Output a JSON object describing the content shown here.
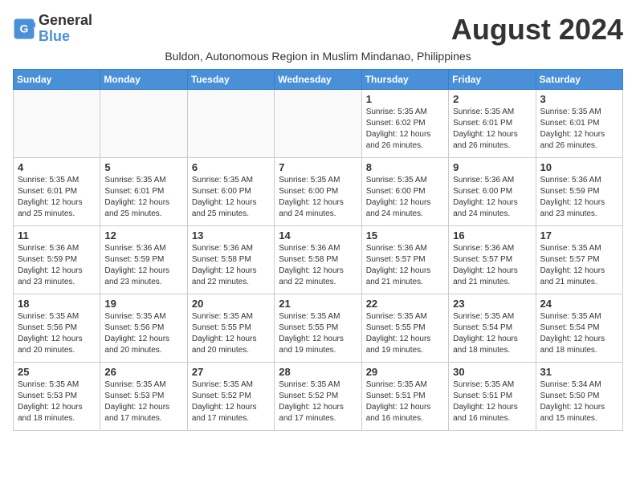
{
  "logo": {
    "line1": "General",
    "line2": "Blue"
  },
  "title": "August 2024",
  "subtitle": "Buldon, Autonomous Region in Muslim Mindanao, Philippines",
  "days_header": [
    "Sunday",
    "Monday",
    "Tuesday",
    "Wednesday",
    "Thursday",
    "Friday",
    "Saturday"
  ],
  "weeks": [
    [
      {
        "day": "",
        "info": ""
      },
      {
        "day": "",
        "info": ""
      },
      {
        "day": "",
        "info": ""
      },
      {
        "day": "",
        "info": ""
      },
      {
        "day": "1",
        "info": "Sunrise: 5:35 AM\nSunset: 6:02 PM\nDaylight: 12 hours\nand 26 minutes."
      },
      {
        "day": "2",
        "info": "Sunrise: 5:35 AM\nSunset: 6:01 PM\nDaylight: 12 hours\nand 26 minutes."
      },
      {
        "day": "3",
        "info": "Sunrise: 5:35 AM\nSunset: 6:01 PM\nDaylight: 12 hours\nand 26 minutes."
      }
    ],
    [
      {
        "day": "4",
        "info": "Sunrise: 5:35 AM\nSunset: 6:01 PM\nDaylight: 12 hours\nand 25 minutes."
      },
      {
        "day": "5",
        "info": "Sunrise: 5:35 AM\nSunset: 6:01 PM\nDaylight: 12 hours\nand 25 minutes."
      },
      {
        "day": "6",
        "info": "Sunrise: 5:35 AM\nSunset: 6:00 PM\nDaylight: 12 hours\nand 25 minutes."
      },
      {
        "day": "7",
        "info": "Sunrise: 5:35 AM\nSunset: 6:00 PM\nDaylight: 12 hours\nand 24 minutes."
      },
      {
        "day": "8",
        "info": "Sunrise: 5:35 AM\nSunset: 6:00 PM\nDaylight: 12 hours\nand 24 minutes."
      },
      {
        "day": "9",
        "info": "Sunrise: 5:36 AM\nSunset: 6:00 PM\nDaylight: 12 hours\nand 24 minutes."
      },
      {
        "day": "10",
        "info": "Sunrise: 5:36 AM\nSunset: 5:59 PM\nDaylight: 12 hours\nand 23 minutes."
      }
    ],
    [
      {
        "day": "11",
        "info": "Sunrise: 5:36 AM\nSunset: 5:59 PM\nDaylight: 12 hours\nand 23 minutes."
      },
      {
        "day": "12",
        "info": "Sunrise: 5:36 AM\nSunset: 5:59 PM\nDaylight: 12 hours\nand 23 minutes."
      },
      {
        "day": "13",
        "info": "Sunrise: 5:36 AM\nSunset: 5:58 PM\nDaylight: 12 hours\nand 22 minutes."
      },
      {
        "day": "14",
        "info": "Sunrise: 5:36 AM\nSunset: 5:58 PM\nDaylight: 12 hours\nand 22 minutes."
      },
      {
        "day": "15",
        "info": "Sunrise: 5:36 AM\nSunset: 5:57 PM\nDaylight: 12 hours\nand 21 minutes."
      },
      {
        "day": "16",
        "info": "Sunrise: 5:36 AM\nSunset: 5:57 PM\nDaylight: 12 hours\nand 21 minutes."
      },
      {
        "day": "17",
        "info": "Sunrise: 5:35 AM\nSunset: 5:57 PM\nDaylight: 12 hours\nand 21 minutes."
      }
    ],
    [
      {
        "day": "18",
        "info": "Sunrise: 5:35 AM\nSunset: 5:56 PM\nDaylight: 12 hours\nand 20 minutes."
      },
      {
        "day": "19",
        "info": "Sunrise: 5:35 AM\nSunset: 5:56 PM\nDaylight: 12 hours\nand 20 minutes."
      },
      {
        "day": "20",
        "info": "Sunrise: 5:35 AM\nSunset: 5:55 PM\nDaylight: 12 hours\nand 20 minutes."
      },
      {
        "day": "21",
        "info": "Sunrise: 5:35 AM\nSunset: 5:55 PM\nDaylight: 12 hours\nand 19 minutes."
      },
      {
        "day": "22",
        "info": "Sunrise: 5:35 AM\nSunset: 5:55 PM\nDaylight: 12 hours\nand 19 minutes."
      },
      {
        "day": "23",
        "info": "Sunrise: 5:35 AM\nSunset: 5:54 PM\nDaylight: 12 hours\nand 18 minutes."
      },
      {
        "day": "24",
        "info": "Sunrise: 5:35 AM\nSunset: 5:54 PM\nDaylight: 12 hours\nand 18 minutes."
      }
    ],
    [
      {
        "day": "25",
        "info": "Sunrise: 5:35 AM\nSunset: 5:53 PM\nDaylight: 12 hours\nand 18 minutes."
      },
      {
        "day": "26",
        "info": "Sunrise: 5:35 AM\nSunset: 5:53 PM\nDaylight: 12 hours\nand 17 minutes."
      },
      {
        "day": "27",
        "info": "Sunrise: 5:35 AM\nSunset: 5:52 PM\nDaylight: 12 hours\nand 17 minutes."
      },
      {
        "day": "28",
        "info": "Sunrise: 5:35 AM\nSunset: 5:52 PM\nDaylight: 12 hours\nand 17 minutes."
      },
      {
        "day": "29",
        "info": "Sunrise: 5:35 AM\nSunset: 5:51 PM\nDaylight: 12 hours\nand 16 minutes."
      },
      {
        "day": "30",
        "info": "Sunrise: 5:35 AM\nSunset: 5:51 PM\nDaylight: 12 hours\nand 16 minutes."
      },
      {
        "day": "31",
        "info": "Sunrise: 5:34 AM\nSunset: 5:50 PM\nDaylight: 12 hours\nand 15 minutes."
      }
    ]
  ]
}
